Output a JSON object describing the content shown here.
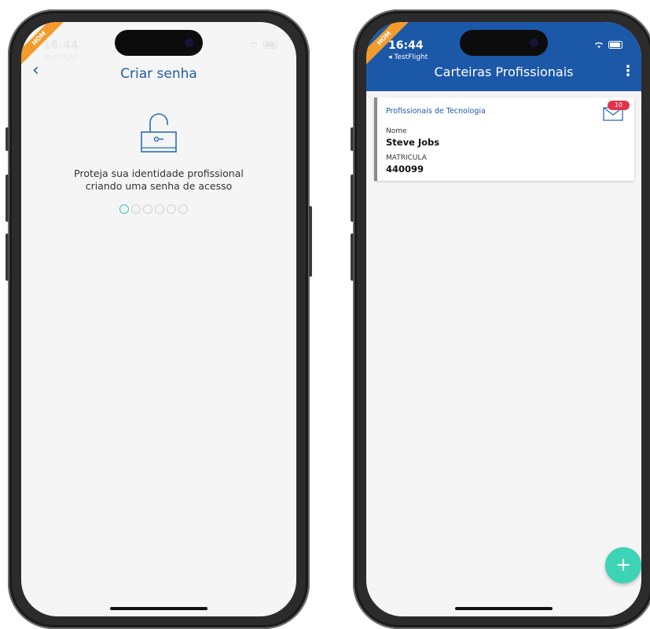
{
  "left_screen": {
    "status": {
      "time": "16:44",
      "app_label": "TestFlight",
      "corner_badge": "HOM"
    },
    "title": "Criar senha",
    "back_label": "‹",
    "description_line1": "Proteja sua identidade profissional",
    "description_line2": "criando uma senha de acesso",
    "pin_total": 6,
    "pin_filled_active": 1
  },
  "right_screen": {
    "status": {
      "time": "16:44",
      "app_label": "◂ TestFlight",
      "corner_badge": "HOM"
    },
    "header_title": "Carteiras Profissionais",
    "menu_icon": "⋮",
    "card": {
      "category": "Profissionais de Tecnologia",
      "label_name": "Nome",
      "value_name": "Steve Jobs",
      "label_id": "MATRICULA",
      "value_id": "440099",
      "mail_badge": "10"
    },
    "fab_label": "+"
  },
  "colors": {
    "primary_blue": "#1c58a8",
    "accent_teal": "#3dd3b5",
    "badge_red": "#e3334a",
    "corner_orange": "#f39c2c"
  }
}
